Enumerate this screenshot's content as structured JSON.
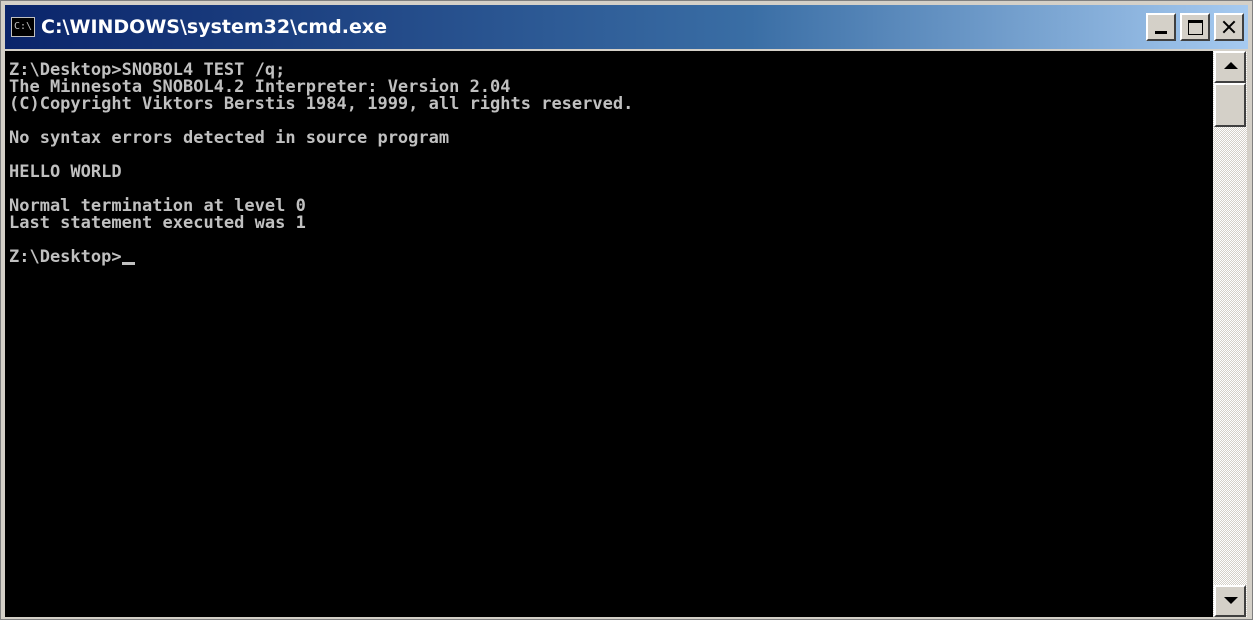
{
  "window": {
    "title": "C:\\WINDOWS\\system32\\cmd.exe",
    "icon_label": "C:\\"
  },
  "console": {
    "lines": [
      "Z:\\Desktop>SNOBOL4 TEST /q;",
      "The Minnesota SNOBOL4.2 Interpreter: Version 2.04",
      "(C)Copyright Viktors Berstis 1984, 1999, all rights reserved.",
      "",
      "No syntax errors detected in source program",
      "",
      "HELLO WORLD",
      "",
      "Normal termination at level 0",
      "Last statement executed was 1",
      "",
      "Z:\\Desktop>"
    ],
    "foreground_color": "#c0c0c0",
    "background_color": "#000000"
  },
  "icons": {
    "app": "console-icon",
    "minimize": "minimize-icon",
    "maximize": "maximize-icon",
    "close": "close-icon",
    "scroll_up": "arrow-up-icon",
    "scroll_down": "arrow-down-icon"
  }
}
